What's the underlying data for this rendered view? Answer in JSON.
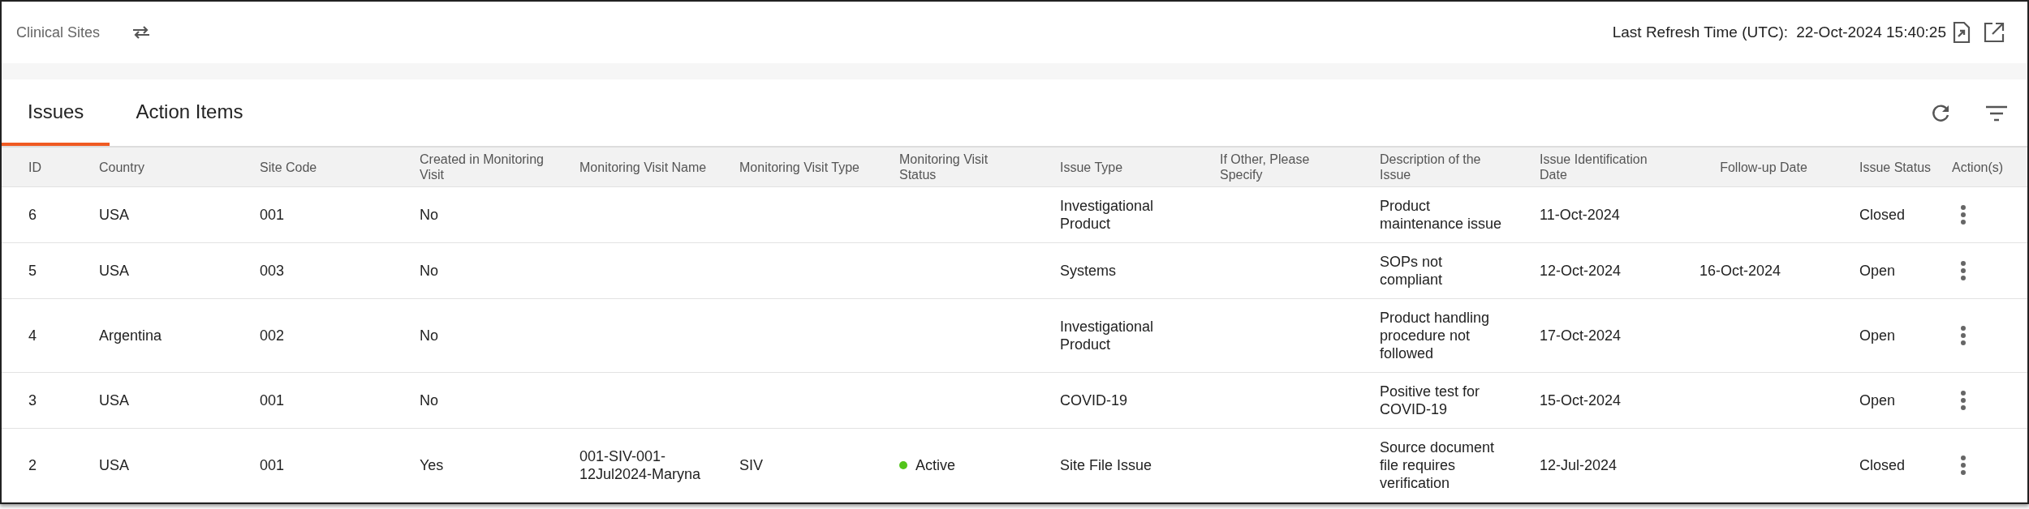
{
  "header": {
    "title": "Clinical Sites",
    "refresh_label": "Last Refresh Time (UTC):",
    "refresh_time": "22-Oct-2024 15:40:25"
  },
  "tabs": [
    {
      "label": "Issues",
      "selected": true
    },
    {
      "label": "Action Items",
      "selected": false
    }
  ],
  "table": {
    "columns": [
      "ID",
      "Country",
      "Site Code",
      "Created in Monitoring Visit",
      "Monitoring Visit Name",
      "Monitoring Visit Type",
      "Monitoring Visit Status",
      "Issue Type",
      "If Other, Please Specify",
      "Description of the Issue",
      "Issue Identification Date",
      "Follow-up Date",
      "Issue Status",
      "Action(s)"
    ],
    "rows": [
      {
        "cells": [
          "6",
          "USA",
          "001",
          "No",
          null,
          null,
          null,
          "Investigational Product",
          null,
          "Product maintenance issue",
          "11-Oct-2024",
          null,
          "Closed"
        ]
      },
      {
        "cells": [
          "5",
          "USA",
          "003",
          "No",
          null,
          null,
          null,
          "Systems",
          null,
          "SOPs not compliant",
          "12-Oct-2024",
          "16-Oct-2024",
          "Open"
        ]
      },
      {
        "cells": [
          "4",
          "Argentina",
          "002",
          "No",
          null,
          null,
          null,
          "Investigational Product",
          null,
          "Product handling procedure not followed",
          "17-Oct-2024",
          null,
          "Open"
        ]
      },
      {
        "cells": [
          "3",
          "USA",
          "001",
          "No",
          null,
          null,
          null,
          "COVID-19",
          null,
          "Positive test for COVID-19",
          "15-Oct-2024",
          null,
          "Open"
        ]
      },
      {
        "cells": [
          "2",
          "USA",
          "001",
          "Yes",
          "001-SIV-001-12Jul2024-Maryna",
          "SIV",
          {
            "text": "Active",
            "color": "#52c41a"
          },
          "Site File Issue",
          null,
          "Source document file requires verification",
          "12-Jul-2024",
          null,
          "Closed"
        ]
      }
    ]
  }
}
